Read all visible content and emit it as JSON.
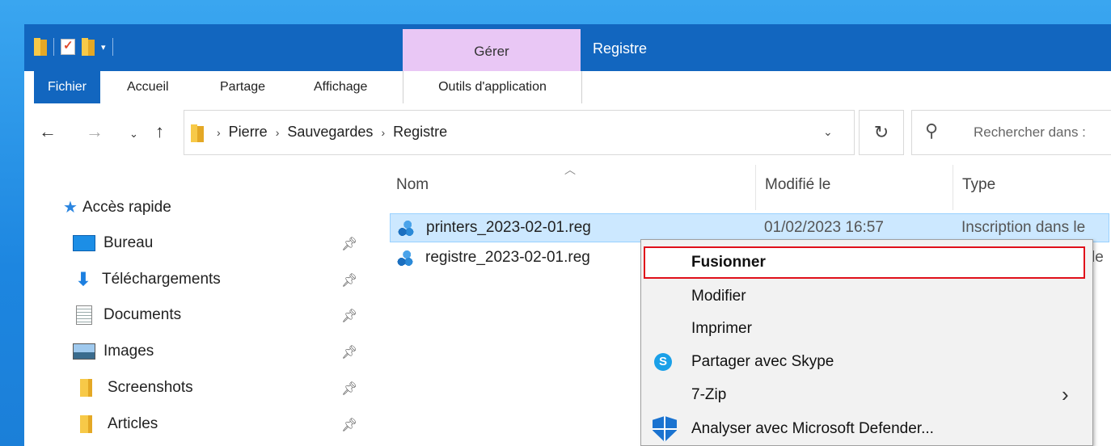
{
  "window": {
    "title": "Registre"
  },
  "context_tab": {
    "label": "Gérer"
  },
  "ribbon": {
    "tabs": [
      {
        "label": "Fichier"
      },
      {
        "label": "Accueil"
      },
      {
        "label": "Partage"
      },
      {
        "label": "Affichage"
      },
      {
        "label": "Outils d'application"
      }
    ]
  },
  "address": {
    "breadcrumbs": [
      "Pierre",
      "Sauvegardes",
      "Registre"
    ]
  },
  "search": {
    "placeholder": "Rechercher dans :"
  },
  "nav": {
    "quick_access": "Accès rapide",
    "items": [
      {
        "label": "Bureau",
        "icon": "desktop-icon"
      },
      {
        "label": "Téléchargements",
        "icon": "download-icon"
      },
      {
        "label": "Documents",
        "icon": "documents-icon"
      },
      {
        "label": "Images",
        "icon": "images-icon"
      },
      {
        "label": "Screenshots",
        "icon": "folder-icon"
      },
      {
        "label": "Articles",
        "icon": "folder-icon"
      }
    ]
  },
  "columns": {
    "name": "Nom",
    "modified": "Modifié le",
    "type": "Type"
  },
  "files": [
    {
      "name": "printers_2023-02-01.reg",
      "modified": "01/02/2023 16:57",
      "type": "Inscription dans le",
      "selected": true
    },
    {
      "name": "registre_2023-02-01.reg",
      "modified": "",
      "type": "le",
      "selected": false
    }
  ],
  "context_menu": {
    "items": [
      {
        "label": "Fusionner",
        "default": true,
        "highlighted": true
      },
      {
        "label": "Modifier"
      },
      {
        "label": "Imprimer"
      },
      {
        "label": "Partager avec Skype",
        "icon": "skype-icon"
      },
      {
        "label": "7-Zip",
        "submenu": true
      },
      {
        "label": "Analyser avec Microsoft Defender...",
        "icon": "defender-icon"
      }
    ]
  },
  "colors": {
    "accent": "#1266bf",
    "manage_tab": "#e9c7f5",
    "selection": "#cce8ff",
    "highlight_border": "#e0101a"
  }
}
